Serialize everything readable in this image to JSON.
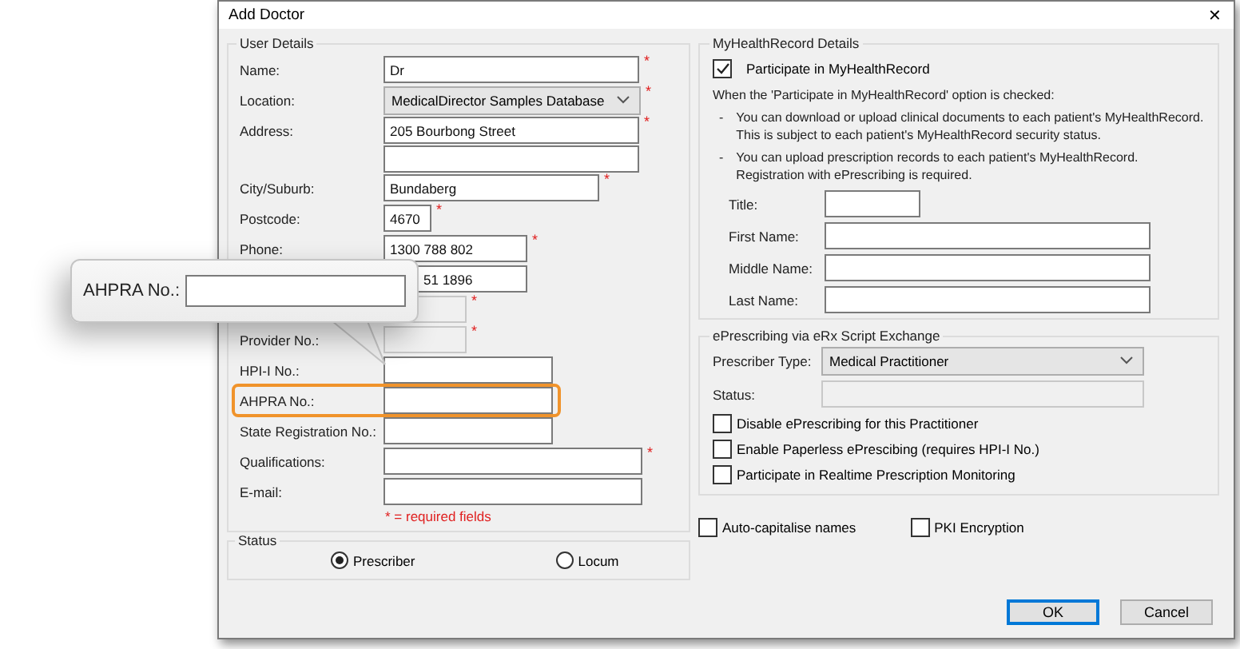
{
  "window": {
    "title": "Add Doctor",
    "close": "✕"
  },
  "user_details": {
    "title": "User Details",
    "fields": [
      {
        "label": "Name:",
        "kind": "text",
        "value": "Dr",
        "marker": "*",
        "disabled": false,
        "highlighted": false
      },
      {
        "label": "Location:",
        "kind": "select",
        "value": "MedicalDirector Samples Database",
        "marker": "*",
        "highlighted": false
      },
      {
        "label": "Address:",
        "kind": "text",
        "value": "205 Bourbong Street",
        "marker": "*",
        "disabled": false,
        "highlighted": false
      },
      {
        "kind": "text",
        "disabled": false,
        "highlighted": false
      },
      {
        "label": "City/Suburb:",
        "kind": "text",
        "value": "Bundaberg",
        "marker": "*",
        "disabled": false,
        "highlighted": false
      },
      {
        "label": "Postcode:",
        "kind": "text",
        "value": "4670",
        "marker": "*",
        "disabled": false,
        "highlighted": false
      },
      {
        "label": "Phone:",
        "kind": "text",
        "value": "1300 788 802",
        "marker": "*",
        "disabled": false,
        "highlighted": false
      },
      {
        "kind": "text",
        "value": "51 1896",
        "disabled": false,
        "highlighted": false
      },
      {
        "kind": "text",
        "marker": "*",
        "disabled": true,
        "highlighted": false
      },
      {
        "label": "Provider No.:",
        "kind": "text",
        "marker": "*",
        "disabled": true,
        "highlighted": false
      },
      {
        "label": "HPI-I No.:",
        "kind": "text",
        "disabled": false,
        "highlighted": false
      },
      {
        "label": "AHPRA No.:",
        "kind": "text",
        "disabled": false,
        "highlighted": true
      },
      {
        "label": "State Registration No.:",
        "kind": "text",
        "disabled": false,
        "highlighted": false
      },
      {
        "label": "Qualifications:",
        "kind": "text",
        "marker": "*",
        "disabled": false,
        "highlighted": false
      },
      {
        "label": "E-mail:",
        "kind": "text",
        "disabled": false,
        "highlighted": false
      }
    ],
    "note": "* = required fields"
  },
  "status": {
    "title": "Status",
    "options": [
      {
        "label": "Prescriber",
        "selected": true
      },
      {
        "label": "Locum",
        "selected": false
      }
    ]
  },
  "my_health_record": {
    "title": "MyHealthRecord Details",
    "participate": {
      "label": "Participate in MyHealthRecord",
      "checked": true
    },
    "intro": "When the 'Participate in MyHealthRecord' option is checked:",
    "bullets": [
      {
        "marker": "-",
        "lines": [
          "You can download or upload clinical documents to each patient's MyHealthRecord.",
          "This is subject to each patient's MyHealthRecord security status."
        ]
      },
      {
        "marker": "-",
        "lines": [
          "You can upload prescription records to each patient's MyHealthRecord.",
          "Registration with ePrescribing is required."
        ]
      }
    ],
    "fields": [
      {
        "label": "Title:",
        "kind": "short"
      },
      {
        "label": "First Name:",
        "kind": "long"
      },
      {
        "label": "Middle Name:",
        "kind": "long"
      },
      {
        "label": "Last Name:",
        "kind": "long"
      }
    ]
  },
  "eprescribing": {
    "title": "ePrescribing via eRx Script Exchange",
    "prescriber_type": {
      "label": "Prescriber Type:",
      "value": "Medical Practitioner"
    },
    "status": {
      "label": "Status:"
    },
    "options": [
      {
        "label": "Disable ePrescribing for this Practitioner",
        "checked": false
      },
      {
        "label": "Enable Paperless ePrescibing (requires HPI-I No.)",
        "checked": false
      },
      {
        "label": "Participate in Realtime Prescription Monitoring",
        "checked": false
      }
    ]
  },
  "options": [
    {
      "label": "Auto-capitalise names",
      "checked": false
    },
    {
      "label": "PKI Encryption",
      "checked": false
    }
  ],
  "buttons": [
    {
      "label": "OK",
      "default": true
    },
    {
      "label": "Cancel",
      "default": false
    }
  ],
  "callout": {
    "label": "AHPRA No.:"
  }
}
